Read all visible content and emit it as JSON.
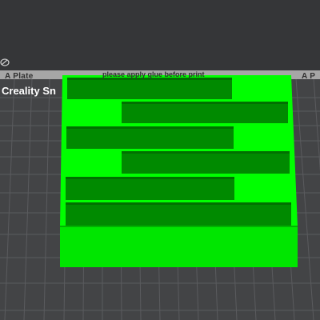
{
  "plate": {
    "left_label": "A Plate",
    "right_label": "A P",
    "center_text": "please apply glue before print",
    "brand": "Creality Sn"
  },
  "icons": {
    "view": "camera-orbit-icon"
  },
  "colors": {
    "background": "#353638",
    "bed_grid_fill": "#454648",
    "bed_grid_line": "#5c5d60",
    "plate_strip": "#a4a4a4",
    "model_bright": "#00ff00",
    "model_dark": "#008800"
  },
  "model": {
    "name": "green-block",
    "slot_count": 6
  }
}
